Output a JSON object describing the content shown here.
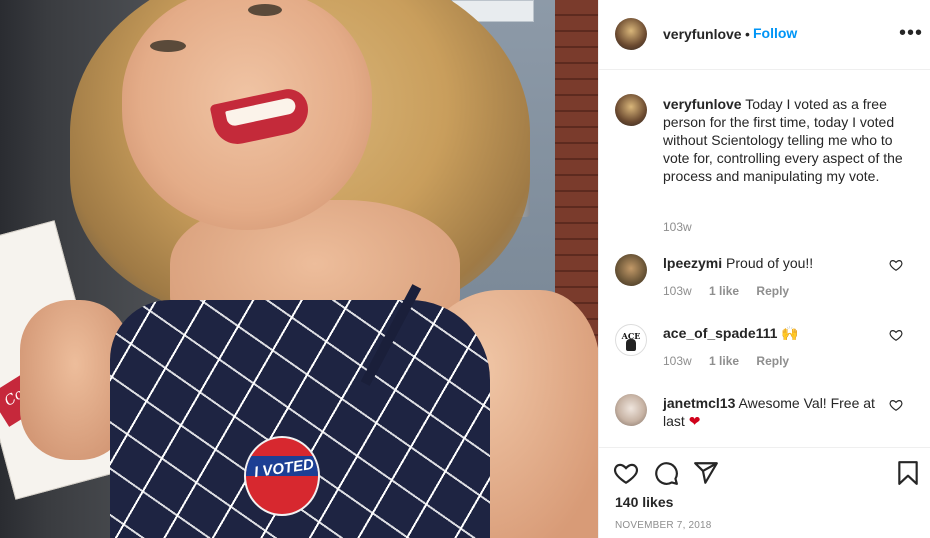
{
  "photo": {
    "sticker_text": "I VOTED",
    "ribbon_text": "Congratulations"
  },
  "post_header": {
    "username": "veryfunlove",
    "separator": "•",
    "follow_label": "Follow",
    "more_icon": "more-horizontal-icon"
  },
  "caption": {
    "username": "veryfunlove",
    "text": "Today I voted as a free person for the first time, today I voted without Scientology telling me who to vote for, controlling every aspect of the process and manipulating my vote.",
    "time": "103w"
  },
  "comments": [
    {
      "username": "lpeezymi",
      "text": "Proud of you!!",
      "emoji": "",
      "time": "103w",
      "likes": "1 like",
      "reply": "Reply"
    },
    {
      "username": "ace_of_spade111",
      "text": "",
      "emoji": "🙌",
      "time": "103w",
      "likes": "1 like",
      "reply": "Reply",
      "avatar_text": "ACE"
    },
    {
      "username": "janetmcl13",
      "text": "Awesome Val! Free at last",
      "emoji": "❤",
      "time": "",
      "likes": "",
      "reply": ""
    }
  ],
  "actions": {
    "like_icon": "heart-icon",
    "comment_icon": "comment-icon",
    "share_icon": "share-icon",
    "save_icon": "bookmark-icon",
    "likes_count": "140 likes",
    "date": "NOVEMBER 7, 2018"
  },
  "colors": {
    "link_blue": "#0095f6",
    "text": "#262626",
    "muted": "#8e8e8e",
    "border": "#efefef",
    "heart_red": "#d0021b"
  }
}
